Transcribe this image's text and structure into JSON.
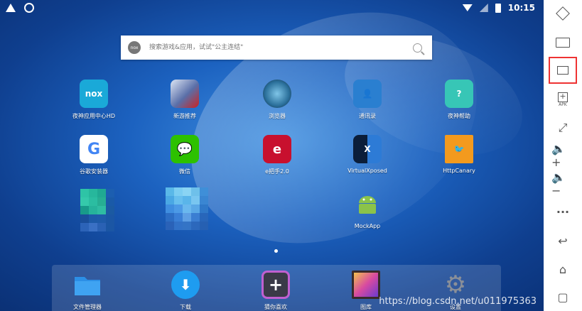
{
  "status": {
    "time": "10:15"
  },
  "search": {
    "placeholder": "搜索游戏&应用，试试\"公主连结\"",
    "logo": "nox"
  },
  "apps": [
    {
      "label": "夜神应用中心HD",
      "icon": "nox-store-icon",
      "color": "#1aa9d8"
    },
    {
      "label": "新游推荐",
      "icon": "game-recommend-icon",
      "color": "#5a6fa8"
    },
    {
      "label": "浏览器",
      "icon": "browser-globe-icon",
      "color": "#2a6f9a"
    },
    {
      "label": "通讯录",
      "icon": "contacts-icon",
      "color": "#2a7fd0"
    },
    {
      "label": "夜神帮助",
      "icon": "help-icon",
      "color": "#37c6b6"
    },
    {
      "label": "谷歌安装器",
      "icon": "google-installer-icon",
      "color": "#ffffff"
    },
    {
      "label": "微信",
      "icon": "wechat-icon",
      "color": "#2dc100"
    },
    {
      "label": "e把手2.0",
      "icon": "ebashou-icon",
      "color": "#c8102e"
    },
    {
      "label": "VirtualXposed",
      "icon": "virtualxposed-icon",
      "color": "#1e4f86"
    },
    {
      "label": "HttpCanary",
      "icon": "httpcanary-icon",
      "color": "#f39a1e"
    },
    {
      "label": "MockApp",
      "icon": "android-robot-icon",
      "color": "#78c257"
    }
  ],
  "dock": [
    {
      "label": "文件管理器",
      "icon": "folder-icon",
      "color": "#2c8fe6"
    },
    {
      "label": "下载",
      "icon": "download-icon",
      "color": "#1e9cf0"
    },
    {
      "label": "猜你喜欢",
      "icon": "plus-icon",
      "color": "#3a3a48"
    },
    {
      "label": "图库",
      "icon": "gallery-icon",
      "color": "#9a5ad0"
    },
    {
      "label": "设置",
      "icon": "settings-gear-icon",
      "color": "#8a8f98"
    }
  ],
  "sidebar": {
    "apk_label": "APK",
    "more_label": "···"
  },
  "watermark": "https://blog.csdn.net/u011975363"
}
